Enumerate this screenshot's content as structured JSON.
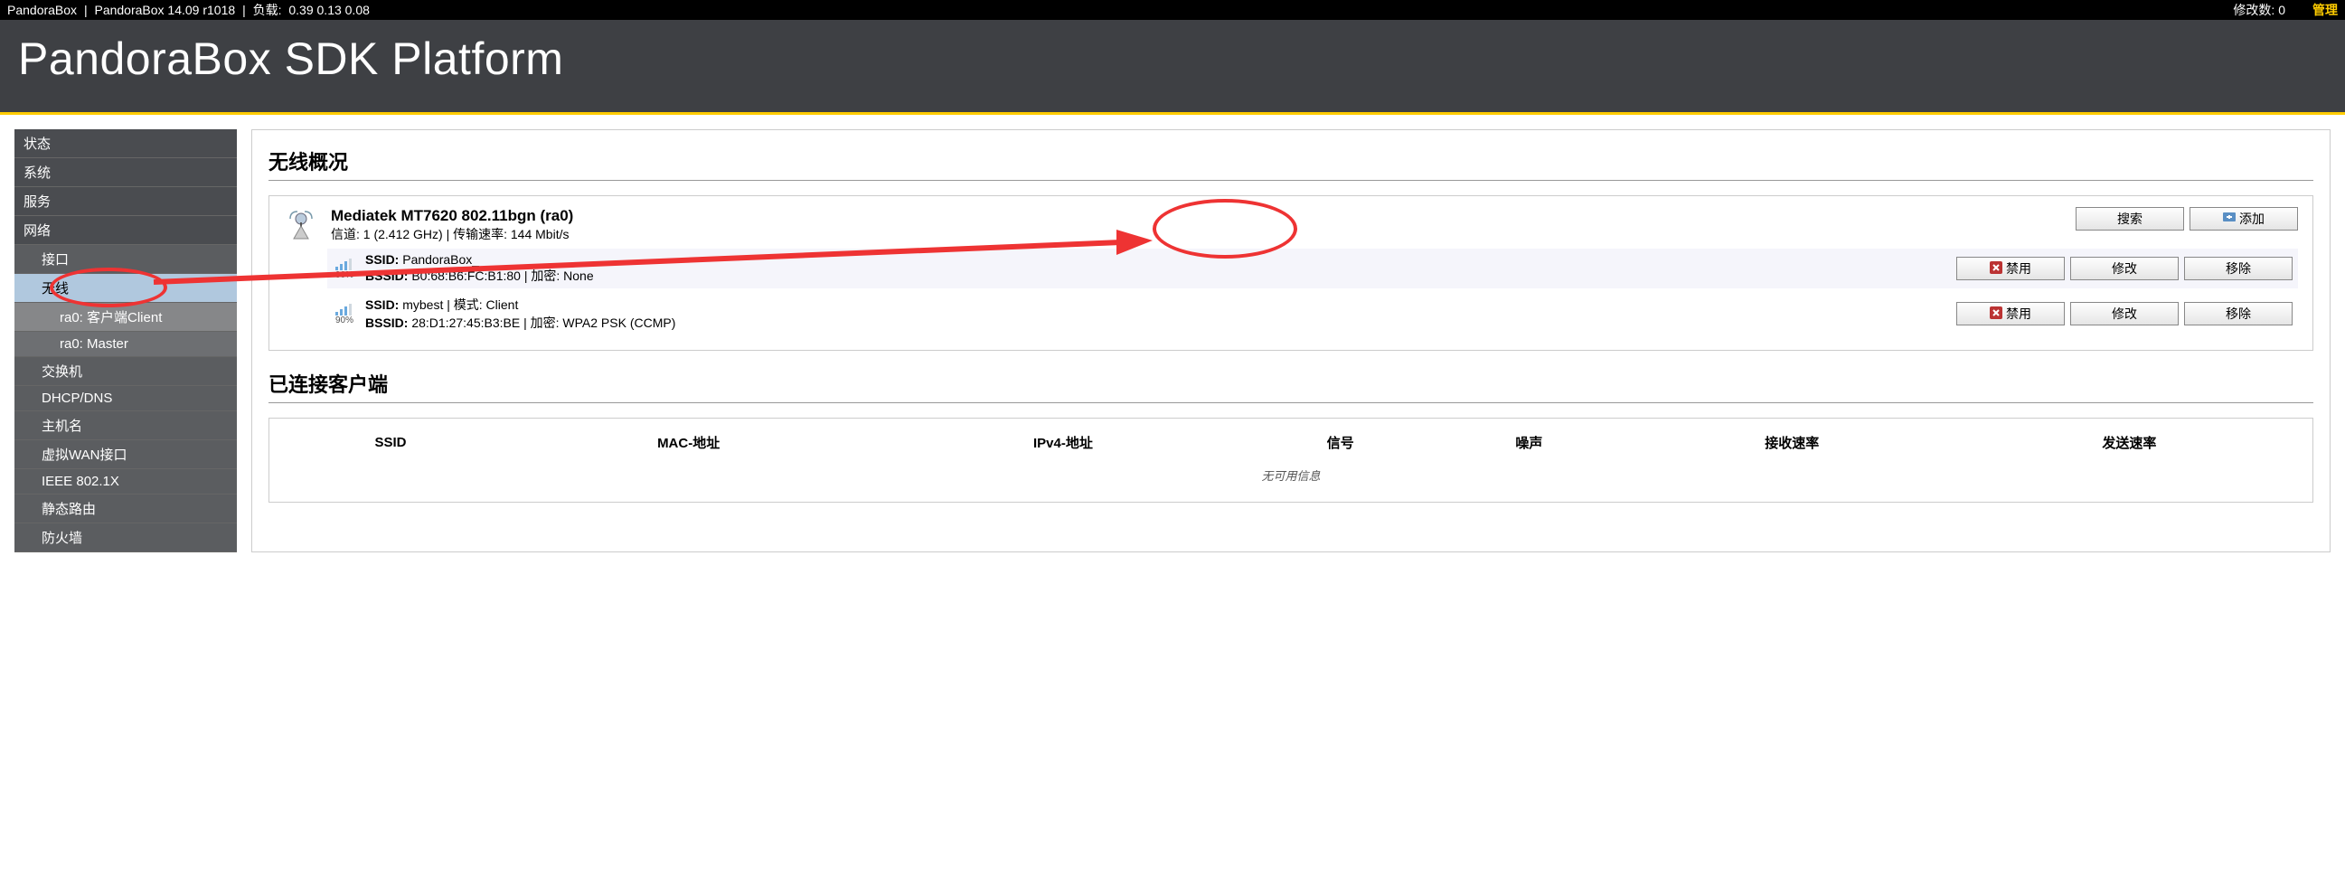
{
  "topbar": {
    "brand": "PandoraBox",
    "version": "PandoraBox 14.09 r1018",
    "load_label": "负载:",
    "load": "0.39 0.13 0.08",
    "mod_label": "修改数:",
    "mod_count": "0",
    "admin": "管理"
  },
  "header": {
    "title": "PandoraBox SDK Platform"
  },
  "sidebar": {
    "items": [
      {
        "label": "状态",
        "lvl": 0
      },
      {
        "label": "系统",
        "lvl": 0
      },
      {
        "label": "服务",
        "lvl": 0
      },
      {
        "label": "网络",
        "lvl": 0
      },
      {
        "label": "接口",
        "lvl": 1
      },
      {
        "label": "无线",
        "lvl": 1,
        "active": true
      },
      {
        "label": "ra0: 客户端Client",
        "lvl": 2,
        "selected": true
      },
      {
        "label": "ra0: Master",
        "lvl": 2
      },
      {
        "label": "交换机",
        "lvl": 1
      },
      {
        "label": "DHCP/DNS",
        "lvl": 1
      },
      {
        "label": "主机名",
        "lvl": 1
      },
      {
        "label": "虚拟WAN接口",
        "lvl": 1
      },
      {
        "label": "IEEE 802.1X",
        "lvl": 1
      },
      {
        "label": "静态路由",
        "lvl": 1
      },
      {
        "label": "防火墙",
        "lvl": 1
      }
    ]
  },
  "overview": {
    "title": "无线概况",
    "device": "Mediatek MT7620 802.11bgn (ra0)",
    "device_sub": "信道: 1 (2.412 GHz) | 传输速率: 144 Mbit/s",
    "scan_btn": "搜索",
    "add_btn": "添加",
    "rows": [
      {
        "pct": "90%",
        "line1_a": "SSID:",
        "line1_b": "PandoraBox_",
        "line2_a": "BSSID:",
        "line2_b": "B0:68:B6:FC:B1:80 | 加密: None",
        "disable": "禁用",
        "edit": "修改",
        "remove": "移除"
      },
      {
        "pct": "90%",
        "line1_a": "SSID:",
        "line1_b": "mybest | 模式: Client",
        "line2_a": "BSSID:",
        "line2_b": "28:D1:27:45:B3:BE | 加密: WPA2 PSK (CCMP)",
        "disable": "禁用",
        "edit": "修改",
        "remove": "移除"
      }
    ]
  },
  "clients": {
    "title": "已连接客户端",
    "headers": [
      "SSID",
      "MAC-地址",
      "IPv4-地址",
      "信号",
      "噪声",
      "接收速率",
      "发送速率"
    ],
    "no_info": "无可用信息"
  }
}
